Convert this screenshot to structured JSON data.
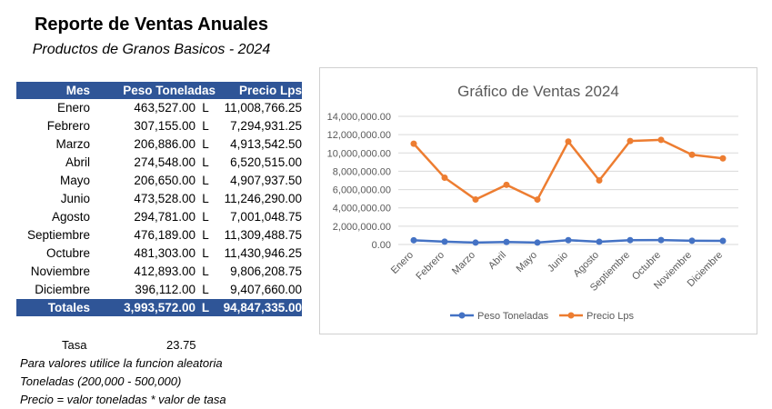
{
  "report": {
    "title": "Reporte de Ventas Anuales",
    "subtitle": "Productos de Granos Basicos - 2024"
  },
  "table": {
    "headers": {
      "mes": "Mes",
      "peso": "Peso Toneladas",
      "precio": "Precio Lps"
    },
    "rows": [
      {
        "mes": "Enero",
        "peso": "463,527.00",
        "cur": "L",
        "precio": "11,008,766.25"
      },
      {
        "mes": "Febrero",
        "peso": "307,155.00",
        "cur": "L",
        "precio": "7,294,931.25"
      },
      {
        "mes": "Marzo",
        "peso": "206,886.00",
        "cur": "L",
        "precio": "4,913,542.50"
      },
      {
        "mes": "Abril",
        "peso": "274,548.00",
        "cur": "L",
        "precio": "6,520,515.00"
      },
      {
        "mes": "Mayo",
        "peso": "206,650.00",
        "cur": "L",
        "precio": "4,907,937.50"
      },
      {
        "mes": "Junio",
        "peso": "473,528.00",
        "cur": "L",
        "precio": "11,246,290.00"
      },
      {
        "mes": "Agosto",
        "peso": "294,781.00",
        "cur": "L",
        "precio": "7,001,048.75"
      },
      {
        "mes": "Septiembre",
        "peso": "476,189.00",
        "cur": "L",
        "precio": "11,309,488.75"
      },
      {
        "mes": "Octubre",
        "peso": "481,303.00",
        "cur": "L",
        "precio": "11,430,946.25"
      },
      {
        "mes": "Noviembre",
        "peso": "412,893.00",
        "cur": "L",
        "precio": "9,806,208.75"
      },
      {
        "mes": "Diciembre",
        "peso": "396,112.00",
        "cur": "L",
        "precio": "9,407,660.00"
      }
    ],
    "totals": {
      "label": "Totales",
      "peso": "3,993,572.00",
      "cur": "L",
      "precio": "94,847,335.00"
    }
  },
  "notes": {
    "tasa_label": "Tasa",
    "tasa_value": "23.75",
    "line1": "Para valores utilice la funcion aleatoria",
    "line2": "Toneladas (200,000 - 500,000)",
    "line3": "Precio = valor toneladas * valor de tasa"
  },
  "colors": {
    "header_bg": "#2f5597",
    "series_peso": "#4472c4",
    "series_precio": "#ed7d31",
    "grid": "#d9d9d9"
  },
  "chart_data": {
    "type": "line",
    "title": "Gráfico de Ventas 2024",
    "categories": [
      "Enero",
      "Febrero",
      "Marzo",
      "Abril",
      "Mayo",
      "Junio",
      "Agosto",
      "Septiembre",
      "Octubre",
      "Noviembre",
      "Diciembre"
    ],
    "series": [
      {
        "name": "Peso Toneladas",
        "color": "#4472c4",
        "values": [
          463527,
          307155,
          206886,
          274548,
          206650,
          473528,
          294781,
          476189,
          481303,
          412893,
          396112
        ]
      },
      {
        "name": "Precio Lps",
        "color": "#ed7d31",
        "values": [
          11008766.25,
          7294931.25,
          4913542.5,
          6520515,
          4907937.5,
          11246290,
          7001048.75,
          11309488.75,
          11430946.25,
          9806208.75,
          9407660
        ]
      }
    ],
    "yticks": [
      "0.00",
      "2,000,000.00",
      "4,000,000.00",
      "6,000,000.00",
      "8,000,000.00",
      "10,000,000.00",
      "12,000,000.00",
      "14,000,000.00"
    ],
    "ylim": [
      0,
      14000000
    ],
    "grid": true,
    "legend": "bottom",
    "xlabel": "",
    "ylabel": ""
  }
}
